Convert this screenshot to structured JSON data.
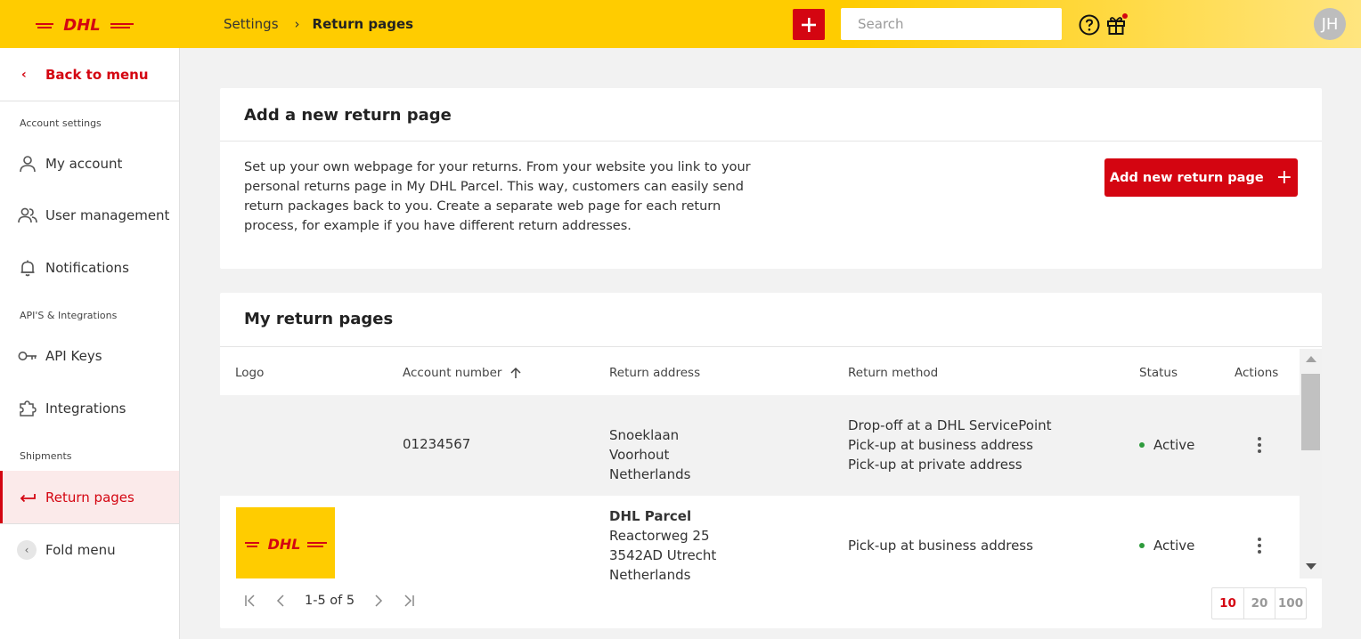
{
  "header": {
    "logo_text": "DHL",
    "breadcrumb": {
      "parent": "Settings",
      "current": "Return pages"
    },
    "search_placeholder": "Search",
    "avatar_initials": "JH",
    "brand_yellow": "#ffcc00",
    "brand_red": "#d40511"
  },
  "sidebar": {
    "back_label": "Back to menu",
    "sections": {
      "account": "Account settings",
      "api": "API'S & Integrations",
      "shipments": "Shipments"
    },
    "items": {
      "my_account": "My account",
      "user_management": "User management",
      "notifications": "Notifications",
      "api_keys": "API Keys",
      "integrations": "Integrations",
      "return_pages": "Return pages"
    },
    "fold_label": "Fold menu"
  },
  "add_card": {
    "title": "Add a new return page",
    "description": "Set up your own webpage for your returns. From your website you link to your personal returns page in My DHL Parcel. This way, customers can easily send return packages back to you. Create a separate web page for each return process, for example if you have different return addresses.",
    "button_label": "Add new return page"
  },
  "list_card": {
    "title": "My return pages",
    "columns": {
      "logo": "Logo",
      "account_number": "Account number",
      "return_address": "Return address",
      "return_method": "Return method",
      "status": "Status",
      "actions": "Actions"
    },
    "rows": [
      {
        "logo": "",
        "account_number": "01234567",
        "address_name": "",
        "address_lines": [
          "Snoeklaan",
          "Voorhout",
          "Netherlands"
        ],
        "methods": [
          "Drop-off at a DHL ServicePoint",
          "Pick-up at business address",
          "Pick-up at private address"
        ],
        "status": "Active"
      },
      {
        "logo": "DHL",
        "account_number": "",
        "address_name": "DHL Parcel",
        "address_lines": [
          "Reactorweg 25",
          "3542AD Utrecht",
          "Netherlands"
        ],
        "methods": [
          "Pick-up at business address"
        ],
        "status": "Active"
      }
    ],
    "pagination": {
      "range_text": "1-5 of 5",
      "page_sizes": [
        "10",
        "20",
        "100"
      ],
      "selected_page_size": "10"
    }
  }
}
